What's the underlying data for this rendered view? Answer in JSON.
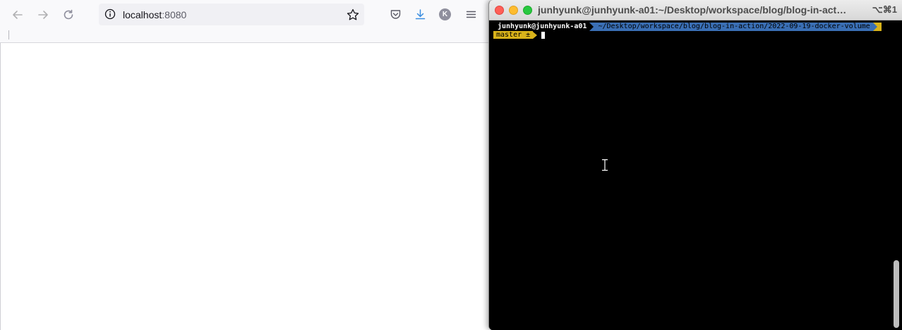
{
  "browser": {
    "url_host": "localhost",
    "url_port": ":8080",
    "account_initial": "K",
    "icons": {
      "back": "arrow-left-icon",
      "forward": "arrow-right-icon",
      "reload": "reload-icon",
      "info": "info-circle-icon",
      "bookmark": "star-icon",
      "pocket": "pocket-icon",
      "downloads": "download-icon",
      "menu": "hamburger-icon"
    }
  },
  "terminal": {
    "title": "junhyunk@junhyunk-a01:~/Desktop/workspace/blog/blog-in-action/...",
    "shortcut": "⌥⌘1",
    "prompt": {
      "user_host": "junhyunk@junhyunk-a01",
      "path": "~/Desktop/workspace/blog/blog-in-action/2022-09-19-docker-volume",
      "git": "master ±"
    },
    "colors": {
      "background": "#000000",
      "path_segment": "#3a6fb5",
      "git_segment": "#d9b31a",
      "close": "#ff5f57",
      "minimize": "#febc2e",
      "zoom": "#28c840"
    }
  }
}
